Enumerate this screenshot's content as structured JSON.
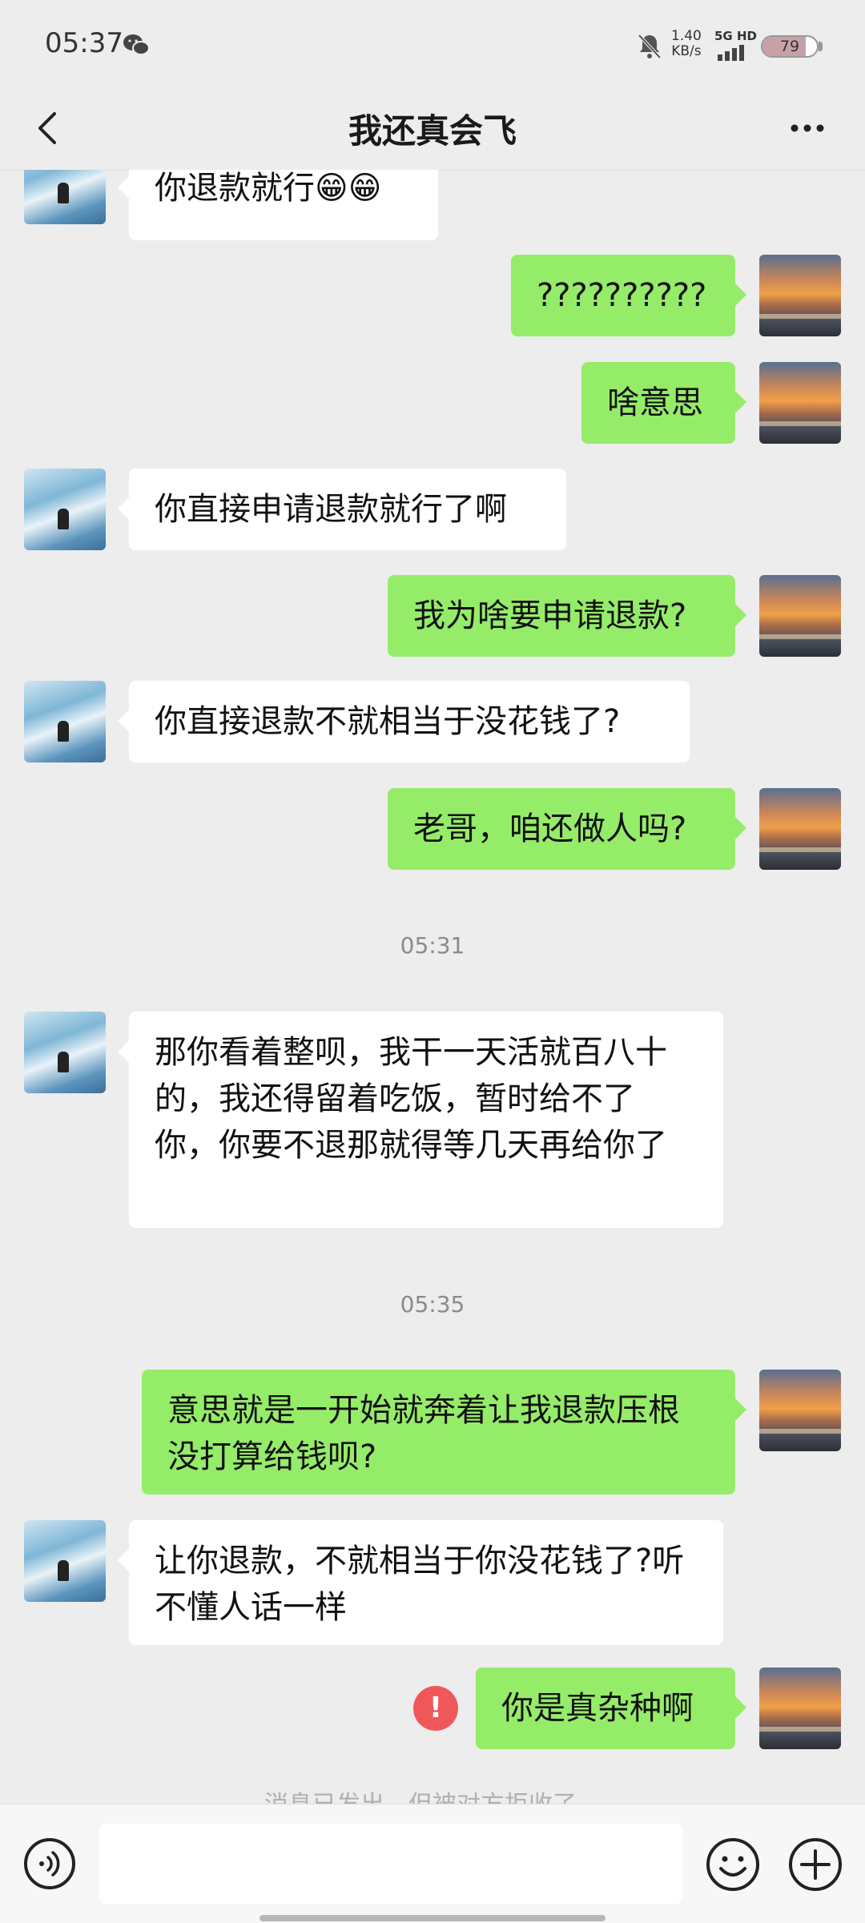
{
  "status_bar": {
    "time": "05:37",
    "net_speed_value": "1.40",
    "net_speed_unit": "KB/s",
    "signal_label": "5G HD",
    "battery": "79",
    "battery_level": 0.79
  },
  "header": {
    "back_icon": "chevron-left-icon",
    "title": "我还真会飞",
    "more_icon": "more-dots-icon"
  },
  "messages": [
    {
      "side": "left",
      "text": "你退款就行😁😁"
    },
    {
      "side": "right",
      "text": "??????????"
    },
    {
      "side": "right",
      "text": "啥意思"
    },
    {
      "side": "left",
      "text": "你直接申请退款就行了啊"
    },
    {
      "side": "right",
      "text": "我为啥要申请退款?"
    },
    {
      "side": "left",
      "text": "你直接退款不就相当于没花钱了?"
    },
    {
      "side": "right",
      "text": "老哥，咱还做人吗?"
    },
    {
      "side": "timestamp",
      "text": "05:31"
    },
    {
      "side": "left",
      "text": "那你看着整呗，我干一天活就百八十的，我还得留着吃饭，暂时给不了你，你要不退那就得等几天再给你了"
    },
    {
      "side": "timestamp",
      "text": "05:35"
    },
    {
      "side": "right",
      "text": "意思就是一开始就奔着让我退款压根没打算给钱呗?"
    },
    {
      "side": "left",
      "text": "让你退款，不就相当于你没花钱了?听不懂人话一样"
    },
    {
      "side": "right",
      "text": "你是真杂种啊",
      "failed": true
    },
    {
      "side": "notice",
      "text": "消息已发出，但被对方拒收了。"
    }
  ],
  "input_bar": {
    "voice_icon": "voice-icon",
    "input_value": "",
    "emoji_icon": "emoji-icon",
    "plus_icon": "plus-icon"
  },
  "colors": {
    "background": "#ededed",
    "bubble_right": "#95ec69",
    "bubble_left": "#ffffff",
    "error": "#f0575b"
  }
}
